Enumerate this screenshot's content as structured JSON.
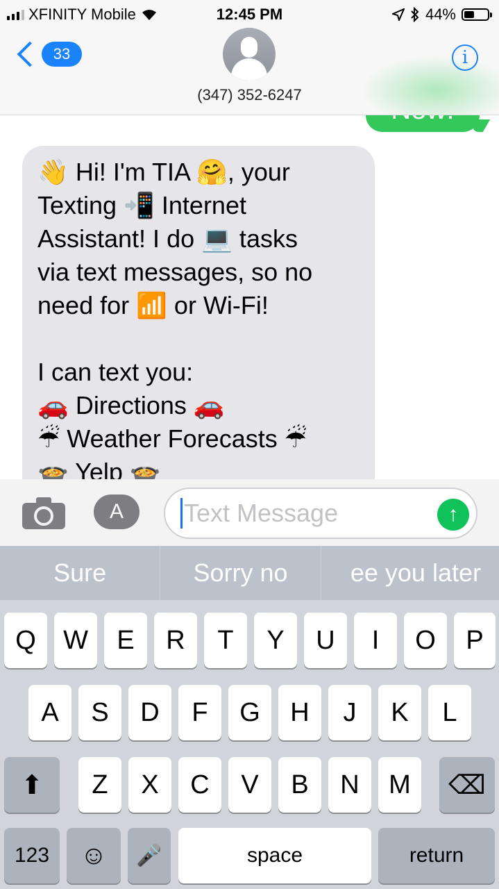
{
  "status_bar": {
    "carrier": "XFINITY Mobile",
    "time": "12:45 PM",
    "battery": "44%",
    "battery_level": 0.44,
    "icons": [
      "signal-bars-icon",
      "wifi-icon",
      "location-arrow-icon",
      "bluetooth-icon",
      "battery-icon"
    ]
  },
  "header": {
    "back_count": "33",
    "contact": "(347) 352-6247",
    "info_glyph": "i"
  },
  "conversation": {
    "sent_partial": "Now!",
    "received_lines": [
      "👋 Hi! I'm TIA 🤗, your",
      "Texting 📲 Internet",
      "Assistant! I do 💻 tasks",
      "via text messages,  so no",
      "need for 📶 or Wi-Fi!",
      "",
      "I can text you:",
      "🚗 Directions 🚗",
      "☔ Weather Forecasts ☔",
      "🍲 Yelp 🍲"
    ]
  },
  "input_bar": {
    "placeholder": "Text Message",
    "send_glyph": "↑",
    "appstore_glyph": "A"
  },
  "keyboard": {
    "suggestions": [
      "Sure",
      "Sorry no",
      "ee you later"
    ],
    "row1": [
      "Q",
      "W",
      "E",
      "R",
      "T",
      "Y",
      "U",
      "I",
      "O",
      "P"
    ],
    "row2": [
      "A",
      "S",
      "D",
      "F",
      "G",
      "H",
      "J",
      "K",
      "L"
    ],
    "row3": [
      "Z",
      "X",
      "C",
      "V",
      "B",
      "N",
      "M"
    ],
    "shift_glyph": "⬆",
    "delete_glyph": "⌫",
    "numbers_label": "123",
    "emoji_glyph": "☺",
    "mic_glyph": "🎤",
    "space_label": "space",
    "return_label": "return"
  }
}
